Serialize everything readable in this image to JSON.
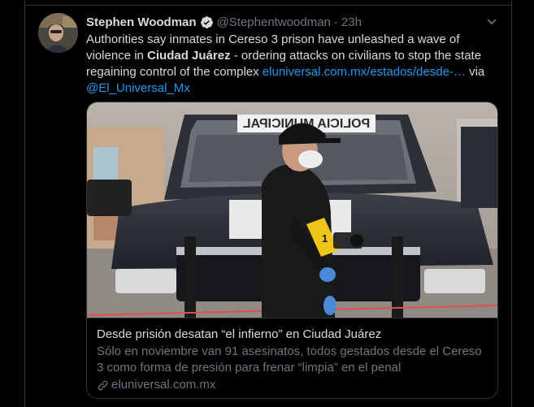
{
  "tweet": {
    "author_name": "Stephen Woodman",
    "handle": "@Stephentwoodman",
    "separator": "·",
    "time": "23h",
    "text_part1": "Authorities say inmates in Cereso 3 prison have unleashed a wave of violence in ",
    "text_bold": "Ciudad Juárez",
    "text_part2": " - ordering attacks on civilians to stop the state regaining control of the complex ",
    "link_url": "eluniversal.com.mx/estados/desde-…",
    "text_via": " via",
    "mention": "@El_Universal_Mx"
  },
  "card": {
    "image_text_hood": "POLICIA MUNICIPAL",
    "marker_number": "1",
    "title": "Desde prisión desatan “el infierno” en Ciudad Juárez",
    "description": "Sólo en noviembre van 91 asesinatos, todos gestados desde el Cereso 3 como forma de presión para frenar “limpia” en el penal",
    "domain": "eluniversal.com.mx"
  },
  "colors": {
    "background": "#000000",
    "text": "#d9d9d9",
    "secondary": "#6e767d",
    "link": "#1d9bf0",
    "border": "#2f3336"
  },
  "icons": {
    "verified": "verified-badge-icon",
    "caret": "chevron-down-icon",
    "link": "link-icon"
  }
}
